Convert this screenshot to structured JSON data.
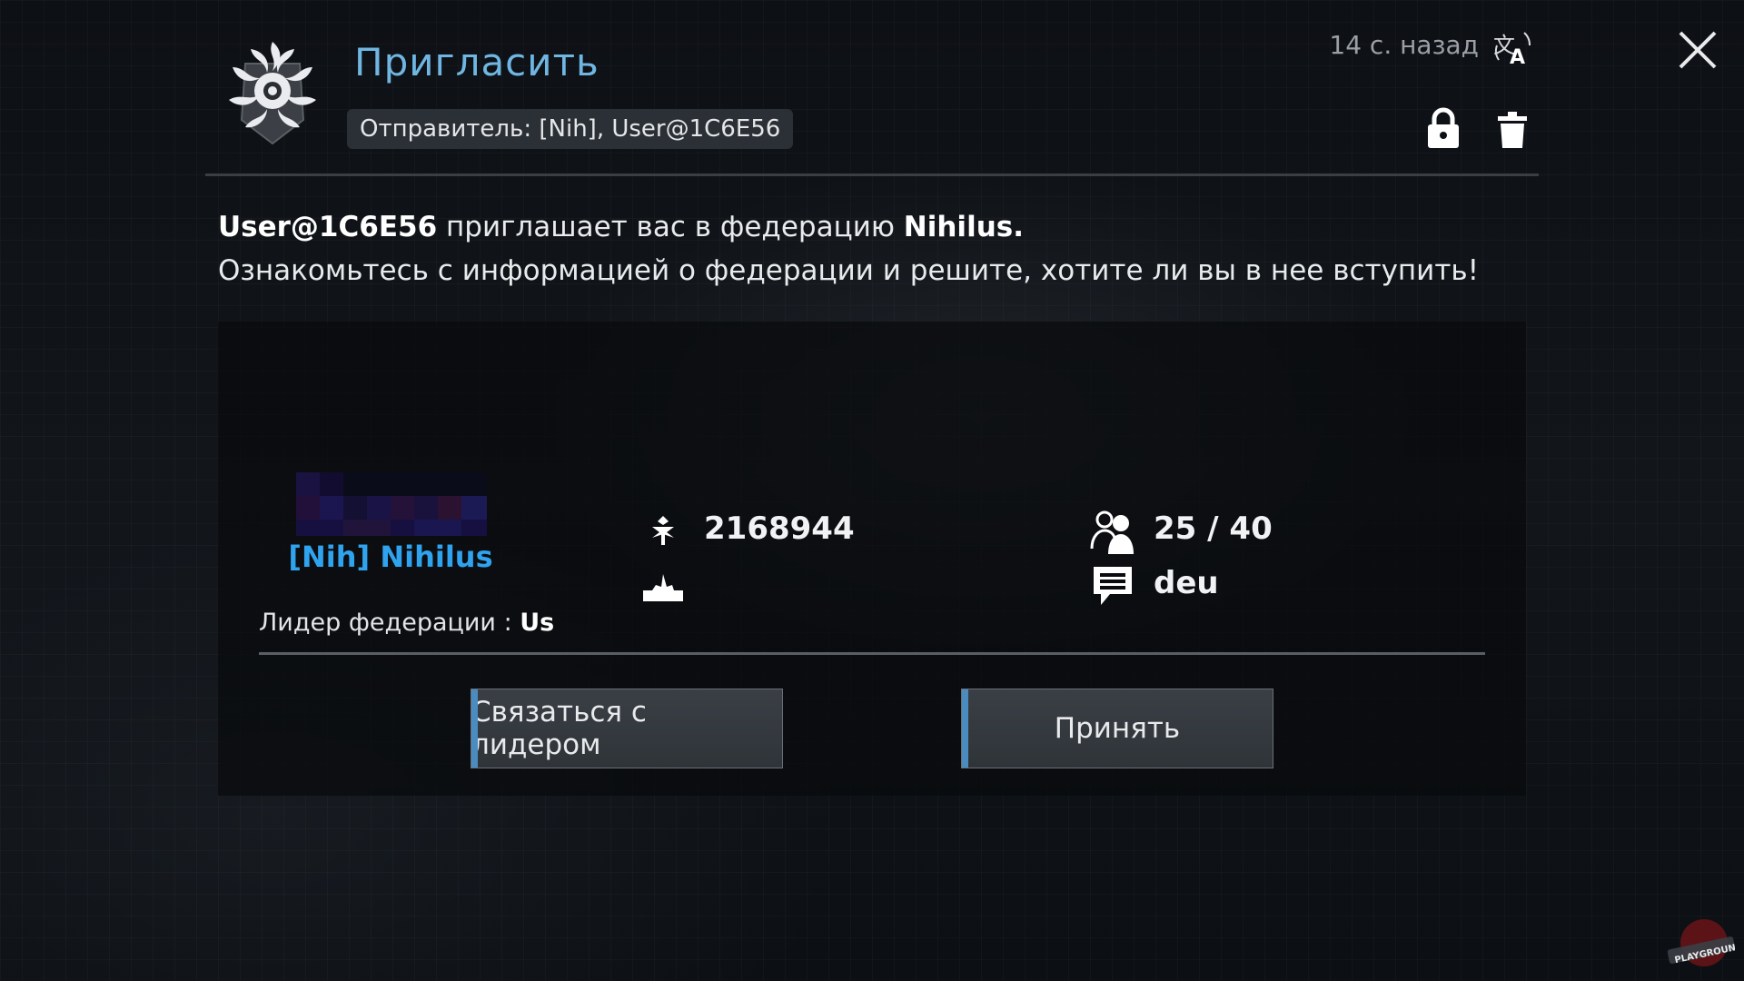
{
  "header": {
    "title": "Пригласить",
    "sender": "Отправитель: [Nih], User@1C6E56",
    "timestamp": "14 с. назад"
  },
  "message": {
    "user": "User@1C6E56",
    "text_mid": " приглашает вас в федерацию ",
    "federation": "Nihilus",
    "text_end": ".",
    "line2": "Ознакомьтесь с информацией о федерации и решите, хотите ли вы в нее вступить!"
  },
  "federation": {
    "name": "[Nih] Nihilus",
    "leader_label": "Лидер федерации : ",
    "leader_name": "Us",
    "power": "2168944",
    "members": "25 / 40",
    "language": "deu"
  },
  "buttons": {
    "contact": "Связаться с лидером",
    "accept": "Принять"
  },
  "colors": {
    "title": "#6fb6e2",
    "federation_name": "#2fa3ee",
    "button_accent": "#4a8cc0"
  },
  "icons": [
    "federation-emblem-icon",
    "translate-icon",
    "close-icon",
    "lock-icon",
    "trash-icon",
    "power-icon",
    "rank-icon",
    "members-icon",
    "language-icon"
  ]
}
